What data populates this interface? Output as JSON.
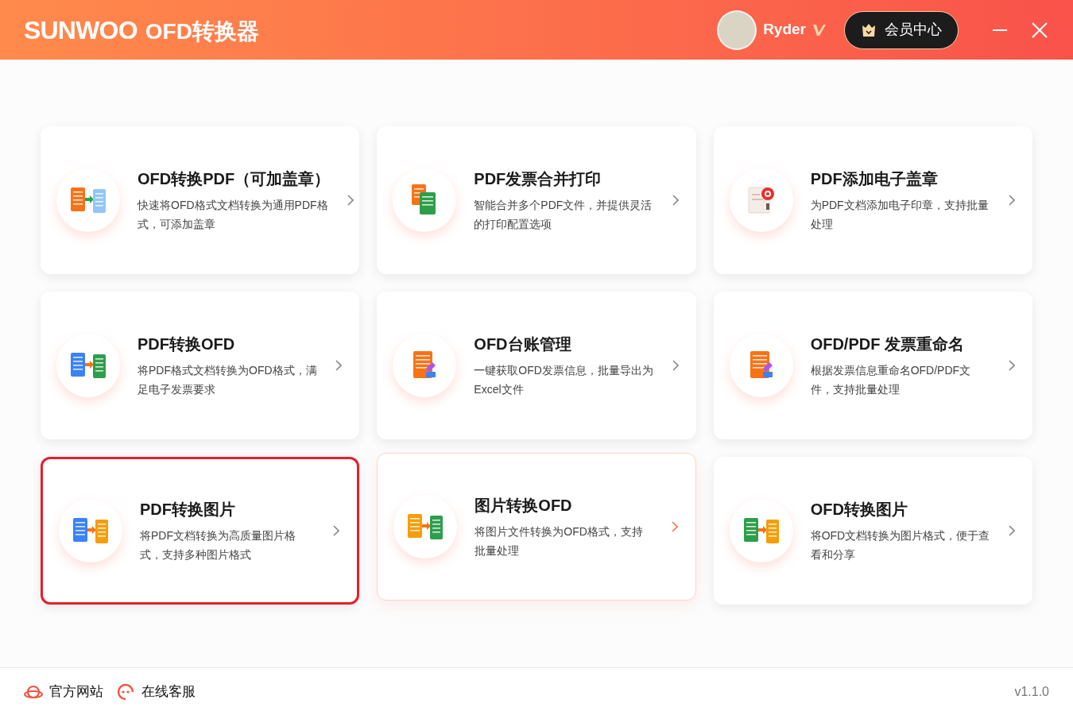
{
  "header": {
    "brand": "SUNWOO",
    "product": "OFD转换器",
    "user": {
      "name": "Ryder"
    },
    "member_button": "会员中心"
  },
  "cards": [
    {
      "title": "OFD转换PDF（可加盖章）",
      "description": "快速将OFD格式文档转换为通用PDF格式，可添加盖章",
      "kind": "ofd-to-pdf",
      "hovered": false,
      "selected": false
    },
    {
      "title": "PDF发票合并打印",
      "description": "智能合并多个PDF文件，并提供灵活的打印配置选项",
      "kind": "merge",
      "hovered": false,
      "selected": false
    },
    {
      "title": "PDF添加电子盖章",
      "description": "为PDF文档添加电子印章，支持批量处理",
      "kind": "stamp",
      "hovered": false,
      "selected": false
    },
    {
      "title": "PDF转换OFD",
      "description": "将PDF格式文档转换为OFD格式，满足电子发票要求",
      "kind": "pdf-to-ofd",
      "hovered": false,
      "selected": false
    },
    {
      "title": "OFD台账管理",
      "description": "一键获取OFD发票信息，批量导出为Excel文件",
      "kind": "ledger",
      "hovered": false,
      "selected": false
    },
    {
      "title": "OFD/PDF 发票重命名",
      "description": "根据发票信息重命名OFD/PDF文件，支持批量处理",
      "kind": "ledger",
      "hovered": false,
      "selected": false
    },
    {
      "title": "PDF转换图片",
      "description": "将PDF文档转换为高质量图片格式，支持多种图片格式",
      "kind": "pdf-to-image",
      "hovered": false,
      "selected": true
    },
    {
      "title": "图片转换OFD",
      "description": "将图片文件转换为OFD格式，支持批量处理",
      "kind": "image-to-ofd",
      "hovered": true,
      "selected": false
    },
    {
      "title": "OFD转换图片",
      "description": "将OFD文档转换为图片格式，便于查看和分享",
      "kind": "ofd-to-image",
      "hovered": false,
      "selected": false
    }
  ],
  "footer": {
    "links": [
      {
        "label": "官方网站",
        "kind": "website"
      },
      {
        "label": "在线客服",
        "kind": "support"
      }
    ],
    "version": "v1.1.0"
  }
}
